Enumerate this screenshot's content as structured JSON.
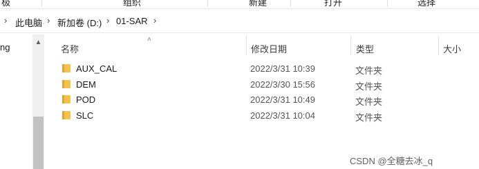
{
  "ribbon": {
    "items": [
      "极",
      "组织",
      "新建",
      "打开",
      "选择"
    ]
  },
  "address": {
    "crumbs": [
      "此电脑",
      "新加卷 (D:)",
      "01-SAR"
    ]
  },
  "nav": {
    "partial_item": "ng"
  },
  "columns": {
    "name": "名称",
    "modified": "修改日期",
    "type": "类型",
    "size": "大小"
  },
  "files": [
    {
      "name": "AUX_CAL",
      "modified": "2022/3/31 10:39",
      "type": "文件夹"
    },
    {
      "name": "DEM",
      "modified": "2022/3/30 15:56",
      "type": "文件夹"
    },
    {
      "name": "POD",
      "modified": "2022/3/31 10:49",
      "type": "文件夹"
    },
    {
      "name": "SLC",
      "modified": "2022/3/31 10:04",
      "type": "文件夹"
    }
  ],
  "watermark": "CSDN @全糖去冰_q",
  "colors": {
    "folder": "#f2c14e",
    "folder_dark": "#dca72e"
  }
}
